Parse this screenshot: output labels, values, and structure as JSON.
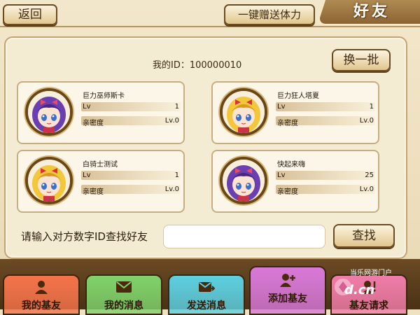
{
  "header": {
    "back_label": "返回",
    "gift_stamina_label": "一键赠送体力",
    "page_title": "好友"
  },
  "my_id_text": "我的ID：100000010",
  "swap_label": "换一批",
  "friends": [
    {
      "name": "巨力巫师斯卡",
      "level_label": "Lv",
      "level": "1",
      "intimacy_label": "亲密度",
      "intimacy": "Lv.0",
      "avatar": "purple-hair-girl"
    },
    {
      "name": "巨力狂人塔夏",
      "level_label": "Lv",
      "level": "1",
      "intimacy_label": "亲密度",
      "intimacy": "Lv.0",
      "avatar": "blonde-hair-girl"
    },
    {
      "name": "白骑士测试",
      "level_label": "Lv",
      "level": "1",
      "intimacy_label": "亲密度",
      "intimacy": "Lv.0",
      "avatar": "blonde-hair-girl"
    },
    {
      "name": "快起来嗨",
      "level_label": "Lv",
      "level": "25",
      "intimacy_label": "亲密度",
      "intimacy": "Lv.0",
      "avatar": "purple-hair-girl"
    }
  ],
  "search": {
    "label": "请输入对方数字ID查找好友",
    "placeholder": "",
    "button_label": "查找"
  },
  "tabs": [
    {
      "label": "我的基友",
      "icon": "person-icon",
      "color": "#f4734a"
    },
    {
      "label": "我的消息",
      "icon": "mail-icon",
      "color": "#7fd26a"
    },
    {
      "label": "发送消息",
      "icon": "send-mail-icon",
      "color": "#5ccfe0"
    },
    {
      "label": "添加基友",
      "icon": "add-friend-icon",
      "color": "#d878d8",
      "active": true
    },
    {
      "label": "基友请求",
      "icon": "friend-request-icon",
      "color": "#f07ca8"
    }
  ],
  "watermark": {
    "text": "当乐网游门户",
    "url": "d.cn"
  }
}
